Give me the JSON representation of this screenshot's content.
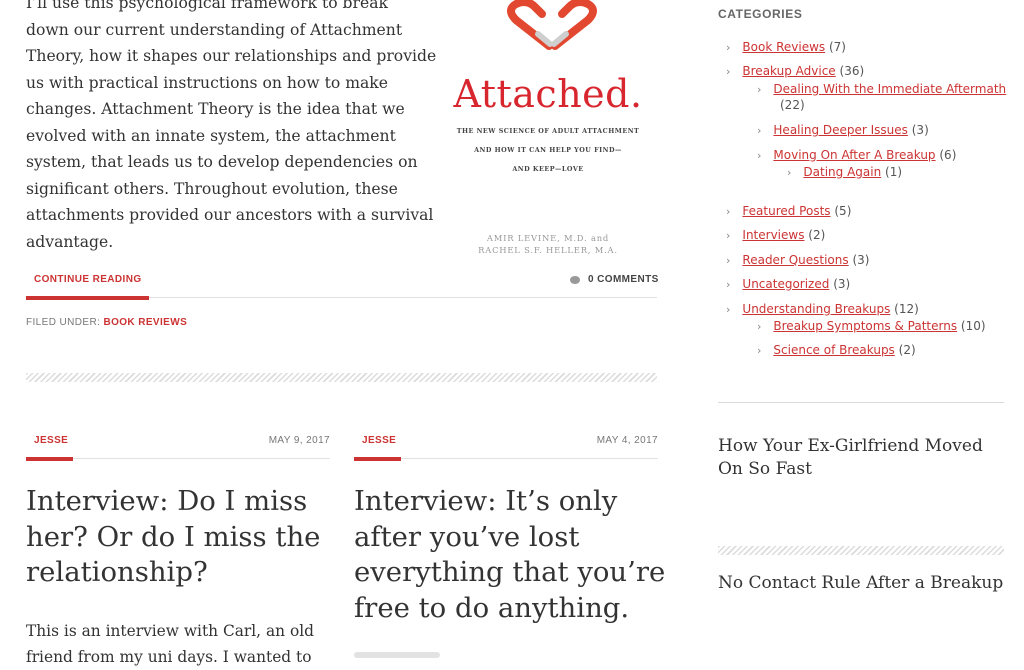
{
  "featured": {
    "excerpt_lines": [
      "I’ll use this psychological framework to break",
      "down our current understanding of Attachment",
      "Theory, how it shapes our relationships and provide",
      "us with practical instructions on how to make",
      "changes. Attachment Theory is the idea that we",
      "evolved with an innate system, the attachment",
      "system, that leads us to develop dependencies on",
      "significant others. Throughout evolution, these",
      "attachments provided our ancestors with a survival",
      "advantage."
    ],
    "book": {
      "title": "Attached.",
      "subtitle_lines": [
        "THE NEW SCIENCE OF ADULT ATTACHMENT",
        "AND HOW IT CAN HELP YOU FIND—",
        "AND KEEP—LOVE"
      ],
      "author_lines": [
        "AMIR LEVINE, M.D. and",
        "RACHEL S.F. HELLER, M.A."
      ]
    },
    "continue_label": "CONTINUE READING",
    "comments_label": "0 COMMENTS",
    "filed_label": "FILED UNDER:",
    "filed_category": "BOOK REVIEWS"
  },
  "posts": [
    {
      "author": "JESSE",
      "date": "MAY 9, 2017",
      "title_lines": [
        "Interview: Do I miss",
        "her? Or do I miss the",
        "relationship?"
      ],
      "excerpt_lines": [
        "This is an interview with Carl, an old",
        "friend from my uni days. I wanted to"
      ]
    },
    {
      "author": "JESSE",
      "date": "MAY 4, 2017",
      "title_lines": [
        "Interview: It’s only",
        "after you’ve lost",
        "everything that you’re",
        "free to do anything."
      ]
    }
  ],
  "sidebar": {
    "categories_heading": "CATEGORIES",
    "categories": [
      {
        "label": "Book Reviews",
        "count": "(7)"
      },
      {
        "label": "Breakup Advice",
        "count": "(36)"
      },
      {
        "label": "Dealing With the Immediate Aftermath",
        "count": "(22)"
      },
      {
        "label": "Healing Deeper Issues",
        "count": "(3)"
      },
      {
        "label": "Moving On After A Breakup",
        "count": "(6)"
      },
      {
        "label": "Dating Again",
        "count": "(1)"
      },
      {
        "label": "Featured Posts",
        "count": "(5)"
      },
      {
        "label": "Interviews",
        "count": "(2)"
      },
      {
        "label": "Reader Questions",
        "count": "(3)"
      },
      {
        "label": "Uncategorized",
        "count": "(3)"
      },
      {
        "label": "Understanding Breakups",
        "count": "(12)"
      },
      {
        "label": "Breakup Symptoms & Patterns",
        "count": "(10)"
      },
      {
        "label": "Science of Breakups",
        "count": "(2)"
      }
    ],
    "widget_posts": [
      {
        "title_lines": [
          "How Your Ex-Girlfriend Moved",
          "On So Fast"
        ]
      },
      {
        "title_lines": [
          "No Contact Rule After a Breakup"
        ]
      }
    ]
  },
  "icons": {
    "chevron": "chevron-right-icon",
    "comment": "comment-bubble-icon",
    "heart": "broken-heart-icon"
  },
  "colors": {
    "accent": "#cc3333",
    "book_title": "#d8262e",
    "text": "#333333",
    "muted": "#777777"
  }
}
